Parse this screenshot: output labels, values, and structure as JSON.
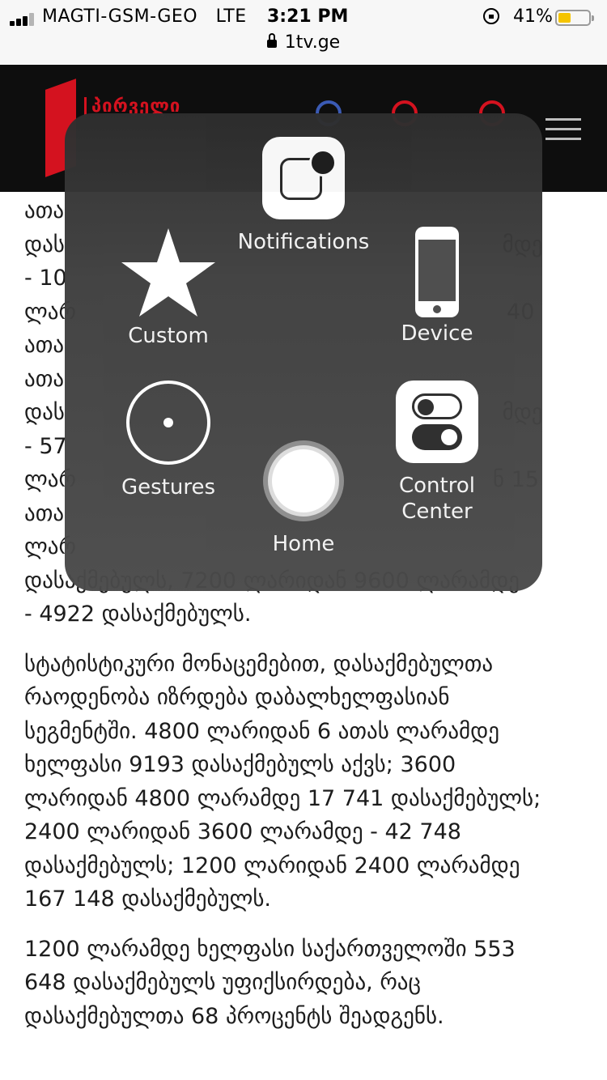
{
  "status_bar": {
    "carrier": "MAGTI-GSM-GEO",
    "network": "LTE",
    "time": "3:21 PM",
    "battery_pct": "41%",
    "battery_level": 0.41,
    "battery_color": "#f5c400",
    "url": "1tv.ge"
  },
  "site": {
    "logo_text": "პირველი",
    "brand_color": "#d4121f",
    "header_icons": [
      "play-blue-icon",
      "play-red-icon",
      "record-red-icon"
    ],
    "menu_icon": "hamburger-icon"
  },
  "article": {
    "paragraph1_lines": [
      "ათა",
      "დას                                                               მდე",
      "- 10",
      "ლარ                                                              40",
      "ათა",
      "ათა",
      "დას                                                               მდე",
      "- 57",
      "ლარ                                                            ნ 15",
      "ათა",
      "ლარ",
      "დასაქმებულს, 7200 ლარიდან 9600 ლარამდე",
      "- 4922 დასაქმებულს."
    ],
    "paragraph2_lines": [
      "სტატისტიკური მონაცემებით, დასაქმებულთა",
      "რაოდენობა იზრდება დაბალხელფასიან",
      "სეგმენტში. 4800 ლარიდან 6 ათას ლარამდე",
      "ხელფასი 9193 დასაქმებულს აქვს; 3600",
      "ლარიდან 4800 ლარამდე 17 741 დასაქმებულს;",
      "2400 ლარიდან 3600 ლარამდე - 42 748",
      "დასაქმებულს; 1200 ლარიდან 2400 ლარამდე",
      "167 148 დასაქმებულს."
    ],
    "paragraph3_lines": [
      "1200 ლარამდე ხელფასი საქართველოში 553",
      "648 დასაქმებულს უფიქსირდება, რაც",
      "დასაქმებულთა 68 პროცენტს შეადგენს."
    ]
  },
  "assistive_touch": {
    "notifications": "Notifications",
    "custom": "Custom",
    "device": "Device",
    "gestures": "Gestures",
    "control_center_line1": "Control",
    "control_center_line2": "Center",
    "home": "Home"
  }
}
